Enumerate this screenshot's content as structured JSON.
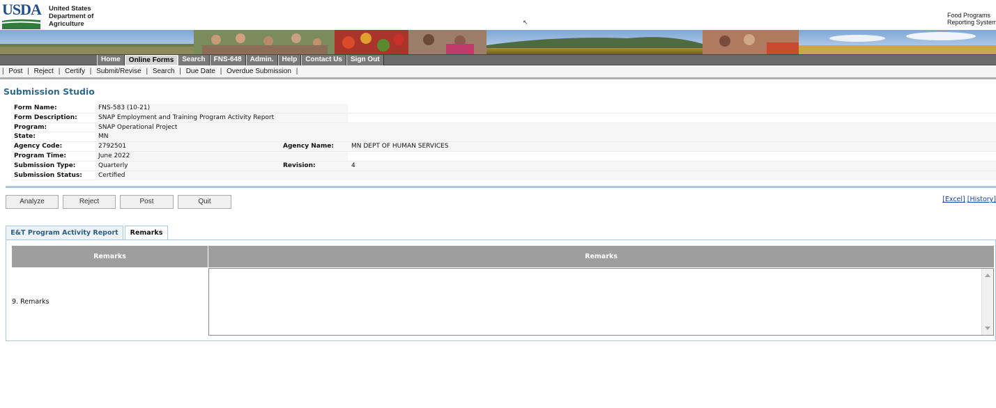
{
  "header": {
    "logo_text": "USDA",
    "agency_lines": [
      "United States",
      "Department of",
      "Agriculture"
    ],
    "cursor_mark": "↖",
    "app_name_lines": [
      "Food Programs",
      "Reporting System"
    ]
  },
  "nav": {
    "items": [
      "Home",
      "Online Forms",
      "Search",
      "FNS-648",
      "Admin.",
      "Help",
      "Contact Us",
      "Sign Out"
    ],
    "active": "Online Forms"
  },
  "submenu": {
    "items": [
      "Post",
      "Reject",
      "Certify",
      "Submit/Revise",
      "Search",
      "Due Date",
      "Overdue Submission"
    ],
    "separator": "|"
  },
  "page_title": "Submission Studio",
  "info": {
    "form_name_label": "Form Name:",
    "form_name": "FNS-583 (10-21)",
    "form_description_label": "Form Description:",
    "form_description": "SNAP Employment and Training Program Activity Report",
    "program_label": "Program:",
    "program": "SNAP Operational Project",
    "state_label": "State:",
    "state": "MN",
    "agency_code_label": "Agency Code:",
    "agency_code": "2792501",
    "agency_name_label": "Agency Name:",
    "agency_name": "MN DEPT OF HUMAN SERVICES",
    "program_time_label": "Program Time:",
    "program_time": "June 2022",
    "submission_type_label": "Submission Type:",
    "submission_type": "Quarterly",
    "revision_label": "Revision:",
    "revision": "4",
    "submission_status_label": "Submission Status:",
    "submission_status": "Certified"
  },
  "buttons": {
    "analyze": "Analyze",
    "reject": "Reject",
    "post": "Post",
    "quit": "Quit"
  },
  "links": {
    "excel": "[Excel]",
    "history": "[History]"
  },
  "tabs": {
    "tab1": "E&T Program Activity Report",
    "tab2": "Remarks"
  },
  "remarks_table": {
    "col1_header": "Remarks",
    "col2_header": "Remarks",
    "row_label": "9. Remarks",
    "value": ""
  },
  "colors": {
    "nav_bg": "#6b6b6b",
    "title": "#2e6b90",
    "table_header": "#9e9e9e",
    "accent_divider": "#a9c6de",
    "link": "#1a3ea8"
  }
}
